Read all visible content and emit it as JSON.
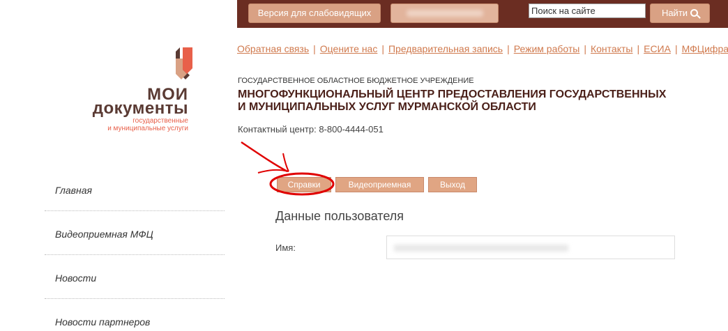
{
  "topbar": {
    "low_vision_label": "Версия для слабовидящих",
    "search_placeholder": "Поиск на сайте",
    "search_button_label": "Найти"
  },
  "logo": {
    "title_line1": "МОИ",
    "title_line2": "документы",
    "subtitle_line1": "государственные",
    "subtitle_line2": "и муниципальные услуги",
    "colors": {
      "brown": "#5a3a33",
      "orange": "#e8604a"
    }
  },
  "top_links": [
    "Обратная связь",
    "Оцените нас",
    "Предварительная запись",
    "Режим работы",
    "Контакты",
    "ЕСИА",
    "МФЦифра"
  ],
  "header": {
    "caption": "Государственное областное бюджетное учреждение",
    "title_line1": "Многофункциональный центр предоставления государственных",
    "title_line2": "и муниципальных услуг Мурманской области",
    "contact": "Контактный центр: 8-800-4444-051"
  },
  "nav": [
    "Главная",
    "Видеоприемная МФЦ",
    "Новости",
    "Новости партнеров"
  ],
  "actions": {
    "spravki": "Справки",
    "video": "Видеоприемная",
    "exit": "Выход"
  },
  "user_data": {
    "section_title": "Данные пользователя",
    "name_label": "Имя:"
  },
  "icons": {
    "search": "magnifier-icon",
    "logo": "logo-mark-icon"
  },
  "colors": {
    "topbar": "#6b2d22",
    "button": "#d9a184",
    "link": "#d07a4e",
    "annotation": "#e00000"
  }
}
